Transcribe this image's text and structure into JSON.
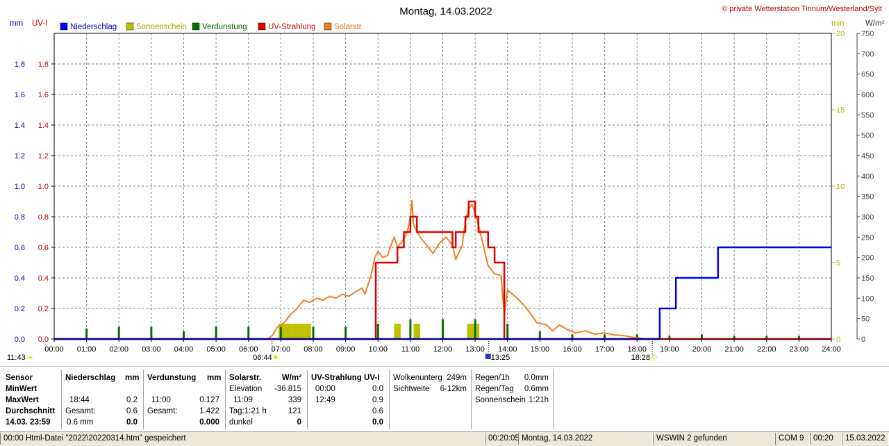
{
  "header": {
    "title": "Montag, 14.03.2022",
    "copyright": "© private Wetterstation Tinnum/Westerland/Sylt"
  },
  "colors": {
    "niederschlag": "#0000ff",
    "sonnenschein": "#c0c000",
    "verdunstung": "#007000",
    "uv": "#e00000",
    "solar": "#f08020",
    "grid": "#808080",
    "left_axis": "#0000c0",
    "uv_axis": "#d00000",
    "min_axis": "#b8b800",
    "wm2_axis": "#404040"
  },
  "chart_data": {
    "type": "line",
    "title": "Montag, 14.03.2022",
    "x_axis": {
      "label": "",
      "range_hours": [
        0,
        24
      ],
      "ticks": [
        "00:00",
        "01:00",
        "02:00",
        "03:00",
        "04:00",
        "05:00",
        "06:00",
        "07:00",
        "08:00",
        "09:00",
        "10:00",
        "11:00",
        "12:00",
        "13:00",
        "14:00",
        "15:00",
        "16:00",
        "17:00",
        "18:00",
        "19:00",
        "20:00",
        "21:00",
        "22:00",
        "23:00",
        "24:00"
      ]
    },
    "axes": {
      "mm": {
        "label": "mm",
        "range": [
          0,
          2
        ],
        "ticks": [
          "0.0",
          "0.2",
          "0.4",
          "0.6",
          "0.8",
          "1.0",
          "1.2",
          "1.4",
          "1.6",
          "1.8"
        ]
      },
      "uv": {
        "label": "UV-I",
        "range": [
          0,
          2
        ],
        "ticks": [
          "0.0",
          "0.2",
          "0.4",
          "0.6",
          "0.8",
          "1.0",
          "1.2",
          "1.4",
          "1.6",
          "1.8"
        ]
      },
      "min": {
        "label": "min",
        "range": [
          0,
          20
        ],
        "ticks": [
          "0",
          "5",
          "10",
          "15",
          "20"
        ]
      },
      "wm2": {
        "label": "W/m²",
        "range": [
          0,
          750
        ],
        "ticks": [
          "0",
          "50",
          "100",
          "150",
          "200",
          "250",
          "300",
          "350",
          "400",
          "450",
          "500",
          "550",
          "600",
          "650",
          "700",
          "750"
        ]
      }
    },
    "grid": true,
    "legend_position": "top-left",
    "legend": [
      "Niederschlag",
      "Sonnenschein",
      "Verdunstung",
      "UV-Strahlung",
      "Solarstr."
    ],
    "series": [
      {
        "name": "Niederschlag",
        "axis": "mm",
        "style": "step",
        "points": [
          [
            0,
            0
          ],
          [
            18.7,
            0
          ],
          [
            18.7,
            0.2
          ],
          [
            19.2,
            0.2
          ],
          [
            19.2,
            0.4
          ],
          [
            20.5,
            0.4
          ],
          [
            20.5,
            0.6
          ],
          [
            24,
            0.6
          ]
        ]
      },
      {
        "name": "UV-Strahlung",
        "axis": "uv",
        "style": "step",
        "points": [
          [
            0,
            0
          ],
          [
            9.93,
            0
          ],
          [
            9.93,
            0.5
          ],
          [
            10.6,
            0.5
          ],
          [
            10.6,
            0.6
          ],
          [
            10.8,
            0.6
          ],
          [
            10.8,
            0.7
          ],
          [
            11.0,
            0.7
          ],
          [
            11.0,
            0.8
          ],
          [
            11.2,
            0.8
          ],
          [
            11.2,
            0.7
          ],
          [
            12.3,
            0.7
          ],
          [
            12.3,
            0.6
          ],
          [
            12.4,
            0.6
          ],
          [
            12.4,
            0.7
          ],
          [
            12.7,
            0.7
          ],
          [
            12.7,
            0.8
          ],
          [
            12.8,
            0.8
          ],
          [
            12.8,
            0.9
          ],
          [
            13.0,
            0.9
          ],
          [
            13.0,
            0.8
          ],
          [
            13.1,
            0.8
          ],
          [
            13.1,
            0.7
          ],
          [
            13.4,
            0.7
          ],
          [
            13.4,
            0.6
          ],
          [
            13.6,
            0.6
          ],
          [
            13.6,
            0.5
          ],
          [
            13.9,
            0.5
          ],
          [
            13.9,
            0
          ],
          [
            24,
            0
          ]
        ]
      },
      {
        "name": "Solarstr.",
        "axis": "wm2",
        "style": "line",
        "points": [
          [
            0,
            0
          ],
          [
            6.6,
            0
          ],
          [
            6.75,
            10
          ],
          [
            6.9,
            30
          ],
          [
            7.1,
            40
          ],
          [
            7.3,
            60
          ],
          [
            7.5,
            75
          ],
          [
            7.7,
            95
          ],
          [
            7.9,
            90
          ],
          [
            8.1,
            100
          ],
          [
            8.3,
            95
          ],
          [
            8.5,
            105
          ],
          [
            8.7,
            100
          ],
          [
            8.9,
            110
          ],
          [
            9.1,
            105
          ],
          [
            9.3,
            115
          ],
          [
            9.5,
            125
          ],
          [
            9.6,
            110
          ],
          [
            9.8,
            160
          ],
          [
            9.9,
            200
          ],
          [
            10.0,
            215
          ],
          [
            10.15,
            200
          ],
          [
            10.3,
            205
          ],
          [
            10.4,
            230
          ],
          [
            10.5,
            250
          ],
          [
            10.6,
            225
          ],
          [
            10.75,
            240
          ],
          [
            10.9,
            260
          ],
          [
            11.0,
            300
          ],
          [
            11.05,
            340
          ],
          [
            11.1,
            280
          ],
          [
            11.3,
            250
          ],
          [
            11.5,
            230
          ],
          [
            11.7,
            210
          ],
          [
            11.9,
            235
          ],
          [
            12.1,
            250
          ],
          [
            12.3,
            230
          ],
          [
            12.4,
            195
          ],
          [
            12.6,
            230
          ],
          [
            12.7,
            290
          ],
          [
            12.8,
            320
          ],
          [
            12.9,
            330
          ],
          [
            13.0,
            310
          ],
          [
            13.1,
            280
          ],
          [
            13.25,
            230
          ],
          [
            13.4,
            180
          ],
          [
            13.6,
            160
          ],
          [
            13.8,
            155
          ],
          [
            13.9,
            60
          ],
          [
            14.0,
            120
          ],
          [
            14.3,
            100
          ],
          [
            14.6,
            75
          ],
          [
            14.9,
            40
          ],
          [
            15.2,
            35
          ],
          [
            15.4,
            20
          ],
          [
            15.6,
            35
          ],
          [
            15.8,
            25
          ],
          [
            16.1,
            15
          ],
          [
            16.4,
            20
          ],
          [
            16.7,
            12
          ],
          [
            17.0,
            15
          ],
          [
            17.3,
            10
          ],
          [
            17.6,
            8
          ],
          [
            17.9,
            4
          ],
          [
            18.2,
            1
          ],
          [
            18.47,
            0
          ],
          [
            24,
            0
          ]
        ]
      },
      {
        "name": "Sonnenschein",
        "axis": "min",
        "style": "bars",
        "bars": [
          [
            6.93,
            1.0
          ],
          [
            7.13,
            1.0
          ],
          [
            7.33,
            1.0
          ],
          [
            7.53,
            1.0
          ],
          [
            7.73,
            1.0
          ],
          [
            10.5,
            1.0
          ],
          [
            11.1,
            1.0
          ],
          [
            12.75,
            1.0
          ],
          [
            12.93,
            1.0
          ]
        ]
      },
      {
        "name": "Verdunstung",
        "axis": "mm",
        "style": "ticks",
        "bars": [
          [
            1,
            0.07
          ],
          [
            2,
            0.08
          ],
          [
            3,
            0.08
          ],
          [
            4,
            0.05
          ],
          [
            5,
            0.08
          ],
          [
            6,
            0.08
          ],
          [
            7,
            0.08
          ],
          [
            8,
            0.08
          ],
          [
            9,
            0.08
          ],
          [
            10,
            0.1
          ],
          [
            11,
            0.13
          ],
          [
            12,
            0.13
          ],
          [
            13,
            0.13
          ],
          [
            14,
            0.1
          ],
          [
            15,
            0.05
          ],
          [
            16,
            0.03
          ],
          [
            17,
            0.03
          ],
          [
            18,
            0.03
          ],
          [
            19,
            0.02
          ],
          [
            20,
            0.03
          ],
          [
            21,
            0.02
          ],
          [
            22,
            0.02
          ],
          [
            23,
            0.02
          ]
        ]
      }
    ],
    "annotations": {
      "sunrise": {
        "hour": 6.73,
        "label": "06:44"
      },
      "sunset": {
        "hour": 18.47,
        "label": "18:28"
      },
      "noon": {
        "hour": 13.42,
        "label": "13:25"
      },
      "moon": {
        "label": "11:43"
      }
    }
  },
  "table": {
    "sensor": {
      "header": "Sensor",
      "min": "MinWert",
      "max": "MaxWert",
      "avg": "Durchschnitt",
      "date": "14.03. 23:59"
    },
    "niederschlag": {
      "header": "Niederschlag",
      "unit": "mm",
      "max_time": "18:44",
      "max_val": "0.2",
      "gesamt_label": "Gesamt:",
      "gesamt_val": "0.6",
      "avg_text": "0.6 mm",
      "avg_val": "0.0"
    },
    "verdunstung": {
      "header": "Verdunstung",
      "unit": "mm",
      "max_time": "11:00",
      "max_val": "0.127",
      "gesamt_label": "Gesamt:",
      "gesamt_val": "1.422",
      "avg_val": "0.000"
    },
    "solar": {
      "header": "Solarstr.",
      "unit": "W/m²",
      "elev_label": "Elevation",
      "elev_val": "-36.815",
      "max_time": "11:09",
      "max_val": "339",
      "tag_label": "Tag:1:21 h",
      "tag_val": "121",
      "dunkel_label": "dunkel",
      "dunkel_val": "0"
    },
    "uv": {
      "header": "UV-Strahlung UV-I",
      "min_time": "00:00",
      "min_val": "0.0",
      "max_time": "12:49",
      "max_val": "0.9",
      "gesamt_val": "0.6",
      "avg_val": "0.0"
    },
    "wolken": {
      "label1": "Wolkenunterg",
      "val1": "249m",
      "label2": "Sichtweite",
      "val2": "6-12km"
    },
    "regen": {
      "label1": "Regen/1h",
      "val1": "0.0mm",
      "label2": "Regen/Tag",
      "val2": "0.6mm",
      "label3": "Sonnenschein",
      "val3": "1:21h"
    }
  },
  "statusbar": {
    "file_msg": "00:00  Html-Datei  \"2022\\20220314.htm\"  gespeichert",
    "time": "00:20:05",
    "date_display": "Montag, 14.03.2022",
    "wswin": "WSWIN 2 gefunden",
    "com": "COM 9",
    "clock": "00:20",
    "date": "15.03.2022"
  }
}
